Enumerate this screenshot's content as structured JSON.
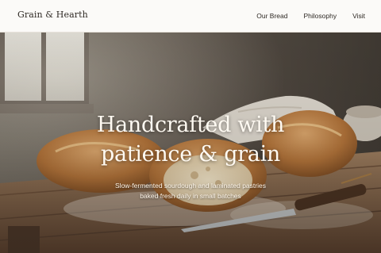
{
  "brand": {
    "name": "Grain & Hearth"
  },
  "nav": {
    "items": [
      {
        "label": "Our Bread"
      },
      {
        "label": "Philosophy"
      },
      {
        "label": "Visit"
      }
    ]
  },
  "hero": {
    "title_line1": "Handcrafted with",
    "title_line2": "patience & grain",
    "subtitle_line1": "Slow-fermented sourdough and laminated pastries",
    "subtitle_line2": "baked fresh daily in small batches"
  },
  "colors": {
    "header_bg": "#fbfaf8",
    "text_dark": "#2f2a25",
    "hero_text": "#fffaf2",
    "wood": "#8a6a4c",
    "crust": "#b57a44"
  }
}
